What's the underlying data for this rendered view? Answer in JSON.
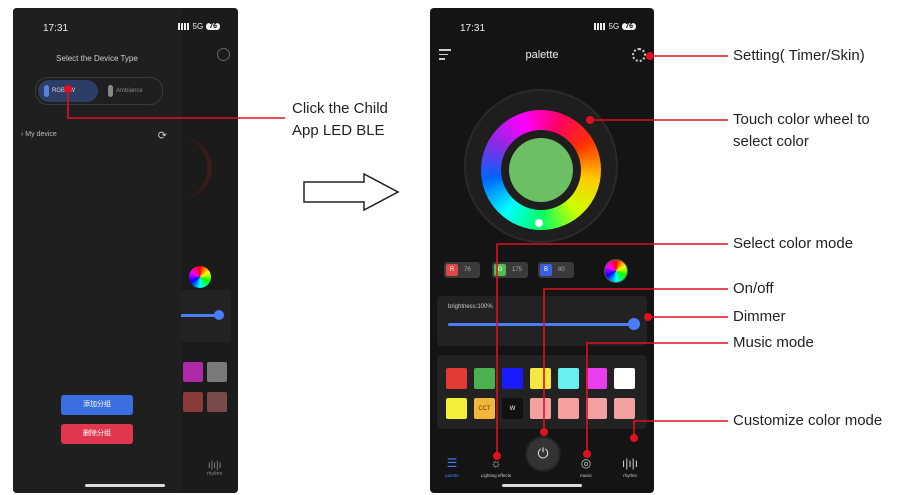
{
  "left_phone": {
    "status": {
      "time": "17:31",
      "network": "5G",
      "battery": "76"
    },
    "drawer": {
      "title": "Select the Device Type",
      "types": [
        {
          "label": "RGBCW"
        },
        {
          "label": "Ambiance"
        }
      ],
      "my_device_label": "My device",
      "add_group_label": "添加分组",
      "delete_group_label": "删除分组"
    },
    "peek_rhythm_label": "rhythm"
  },
  "right_phone": {
    "status": {
      "time": "17:31",
      "network": "5G",
      "battery": "76"
    },
    "header_title": "palette",
    "current_color": "#6cbf63",
    "rgb": [
      {
        "tag": "R",
        "value": "76",
        "color": "#e04848"
      },
      {
        "tag": "G",
        "value": "175",
        "color": "#4cbf4c"
      },
      {
        "tag": "B",
        "value": "80",
        "color": "#3b5fe0"
      }
    ],
    "brightness_label": "brightness:100%",
    "brightness_fraction": 1.0,
    "swatches_row1": [
      "#e53935",
      "#4caf50",
      "#1a1aff",
      "#f5e642",
      "#66f0f0",
      "#e83ef0",
      "#ffffff"
    ],
    "swatches_row2": [
      {
        "color": "#f2ee3a",
        "text": ""
      },
      {
        "color": "#f2b73a",
        "text": "CCT"
      },
      {
        "color": "#111111",
        "text": "W"
      },
      {
        "color": "#f4a0a0",
        "text": ""
      },
      {
        "color": "#f4a0a0",
        "text": ""
      },
      {
        "color": "#f4a0a0",
        "text": ""
      },
      {
        "color": "#f4a0a0",
        "text": ""
      }
    ],
    "nav": {
      "palette": "palette",
      "effects": "Lighting effects",
      "music": "music",
      "rhythm": "rhythm"
    }
  },
  "callouts": {
    "child_app": [
      "Click the Child",
      "App LED BLE"
    ],
    "setting": "Setting( Timer/Skin)",
    "touch_wheel": [
      "Touch color wheel to",
      "select color"
    ],
    "select_mode": "Select color mode",
    "onoff": "On/off",
    "dimmer": "Dimmer",
    "music": "Music mode",
    "customize": "Customize color mode"
  },
  "colors": {
    "callout_line": "#e01020",
    "accent_blue": "#4a7cff"
  }
}
